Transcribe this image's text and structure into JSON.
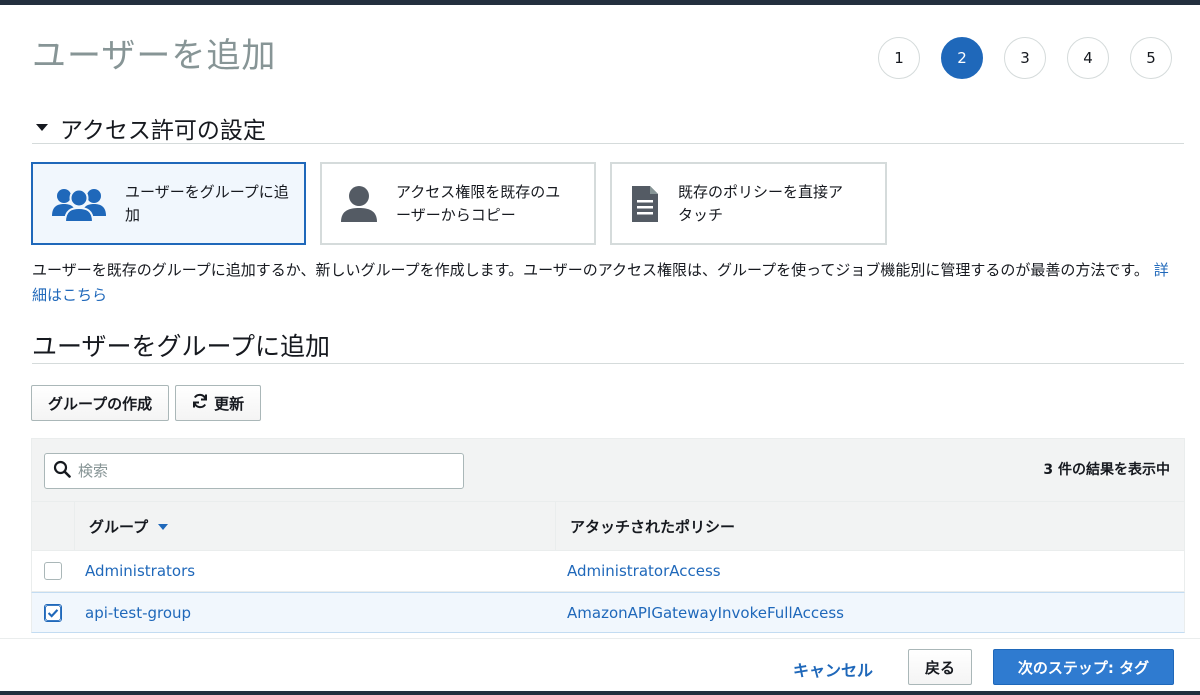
{
  "page": {
    "title": "ユーザーを追加"
  },
  "stepper": {
    "steps": [
      "1",
      "2",
      "3",
      "4",
      "5"
    ],
    "active_step": "2"
  },
  "permissions": {
    "section_title": "アクセス許可の設定",
    "options": [
      {
        "line1": "ユーザーをグループに追",
        "line2": "加",
        "icon": "users-group-icon",
        "selected": true
      },
      {
        "line1": "アクセス権限を既存のユ",
        "line2": "ーザーからコピー",
        "icon": "user-icon",
        "selected": false
      },
      {
        "line1": "既存のポリシーを直接ア",
        "line2": "タッチ",
        "icon": "document-icon",
        "selected": false
      }
    ],
    "description": "ユーザーを既存のグループに追加するか、新しいグループを作成します。ユーザーのアクセス権限は、グループを使ってジョブ機能別に管理するのが最善の方法です。",
    "details_link": "詳細はこちら"
  },
  "groups": {
    "section_title": "ユーザーをグループに追加",
    "create_button": "グループの作成",
    "refresh_button": "更新",
    "search_placeholder": "検索",
    "results_count": "3 件の結果を表示中",
    "columns": {
      "group": "グループ",
      "policy": "アタッチされたポリシー"
    },
    "rows": [
      {
        "group": "Administrators",
        "policy": "AdministratorAccess",
        "checked": false
      },
      {
        "group": "api-test-group",
        "policy": "AmazonAPIGatewayInvokeFullAccess",
        "checked": true
      }
    ]
  },
  "footer": {
    "cancel": "キャンセル",
    "back": "戻る",
    "next": "次のステップ: タグ"
  },
  "colors": {
    "accent": "#1f68ba",
    "header_bar": "#232f3e",
    "title_gray": "#879596",
    "selected_bg": "#f1f7fd"
  }
}
